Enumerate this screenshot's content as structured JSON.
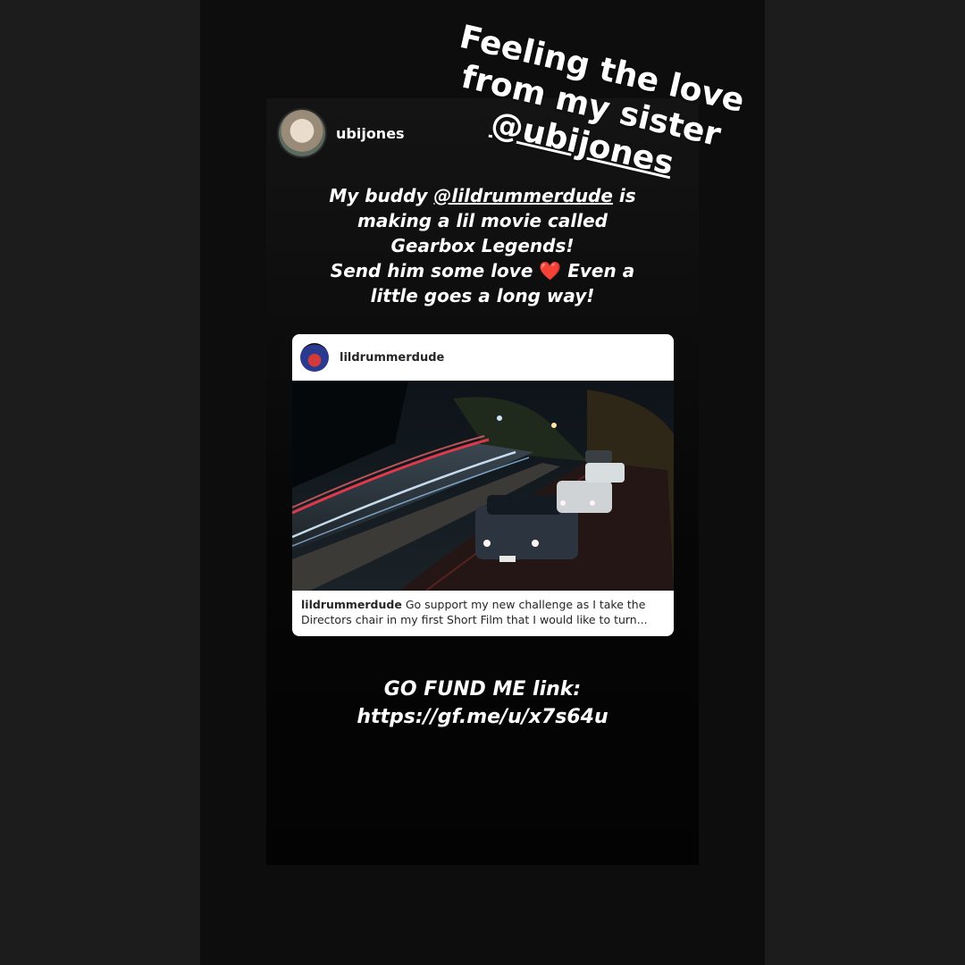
{
  "story": {
    "username": "ubijones",
    "sticker_caption": {
      "line1": "Feeling the love",
      "line2": "from my sister",
      "mention": "@ubijones"
    },
    "message": {
      "line1_prefix": "My buddy ",
      "line1_mention": "@lildrummerdude",
      "line1_suffix": " is",
      "line2": "making a lil movie called",
      "line3": "Gearbox Legends!",
      "line4_prefix": "Send him some love ",
      "heart": "❤️",
      "line4_suffix": " Even a",
      "line5": "little goes a long way!"
    },
    "fund": {
      "line1": "GO FUND ME link:",
      "line2": "https://gf.me/u/x7s64u"
    }
  },
  "post": {
    "username": "lildrummerdude",
    "caption_user": "lildrummerdude",
    "caption_line1": " Go support my new challenge as I take the",
    "caption_line2": "Directors chair in my first Short Film that I would like to turn..."
  },
  "colors": {
    "page_background": "#1c1c1c",
    "story_background": "#0d0d0d",
    "heart": "#e0242f",
    "card_background": "#ffffff"
  },
  "icons": [
    "heart-icon"
  ]
}
